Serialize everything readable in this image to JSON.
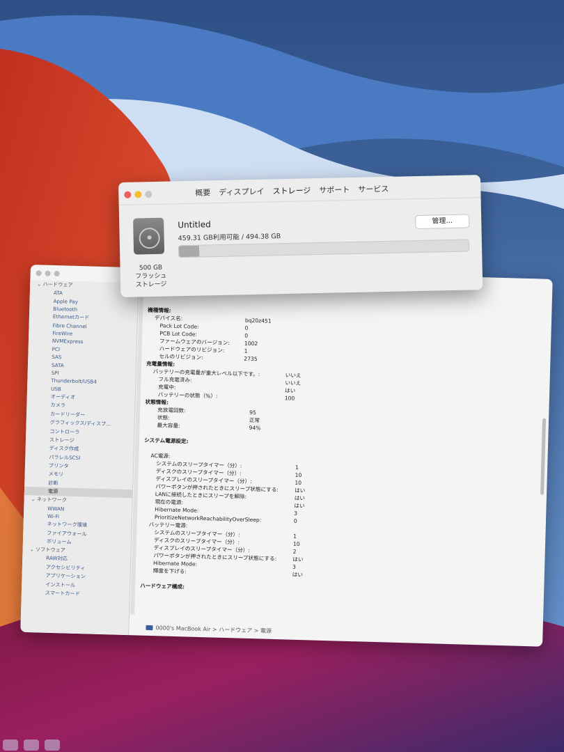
{
  "colors": {
    "close": "#ee5f57",
    "minimize": "#f5bd2f",
    "zoom_inactive": "#c7c7c7",
    "accent": "#3b5d9c"
  },
  "about_window": {
    "tabs": [
      "概要",
      "ディスプレイ",
      "ストレージ",
      "サポート",
      "サービス"
    ],
    "active_tab": "ストレージ",
    "volume_name": "Untitled",
    "usage": "459.31 GB利用可能 / 494.38 GB",
    "used_fraction": 0.07,
    "disk_label_lines": [
      "500 GB",
      "フラッシュ",
      "ストレージ"
    ],
    "manage_button": "管理...",
    "disk_icon": "hard-disk-icon"
  },
  "sidebar": {
    "hardware_group": "ハードウェア",
    "hardware_items": [
      "ATA",
      "Apple Pay",
      "Bluetooth",
      "Ethernetカード",
      "Fibre Channel",
      "FireWire",
      "NVMExpress",
      "PCI",
      "SAS",
      "SATA",
      "SPI",
      "Thunderbolt/USB4",
      "USB",
      "オーディオ",
      "カメラ",
      "カードリーダー",
      "グラフィックス/ディスプ...",
      "コントローラ",
      "ストレージ",
      "ディスク作成",
      "パラレルSCSI",
      "プリンタ",
      "メモリ",
      "診断",
      "電源"
    ],
    "selected_item": "電源",
    "network_group": "ネットワーク",
    "network_items": [
      "WWAN",
      "Wi-Fi",
      "ネットワーク環境",
      "ファイアウォール",
      "ボリューム"
    ],
    "software_group": "ソフトウェア",
    "software_items": [
      "RAW対応",
      "アクセシビリティ",
      "アプリケーション",
      "インストール",
      "スマートカード"
    ]
  },
  "content": {
    "rows": [
      {
        "k": "機種情報:",
        "v": "",
        "indent": 0,
        "bold": true
      },
      {
        "k": "デバイス名:",
        "v": "bq20z451",
        "indent": 1
      },
      {
        "k": "Pack Lot Code:",
        "v": "0",
        "indent": 2
      },
      {
        "k": "PCB Lot Code:",
        "v": "0",
        "indent": 2
      },
      {
        "k": "ファームウェアのバージョン:",
        "v": "1002",
        "indent": 2
      },
      {
        "k": "ハードウェアのリビジョン:",
        "v": "1",
        "indent": 2
      },
      {
        "k": "セルのリビジョン:",
        "v": "2735",
        "indent": 2
      },
      {
        "k": "充電量情報:",
        "v": "",
        "indent": 0,
        "bold": true
      },
      {
        "k": "バッテリーの充電量が重大レベル以下です。:",
        "v": "いいえ",
        "indent": 1,
        "vcol": 2
      },
      {
        "k": "フル充電済み:",
        "v": "いいえ",
        "indent": 2,
        "vcol": 2
      },
      {
        "k": "充電中:",
        "v": "はい",
        "indent": 2,
        "vcol": 2
      },
      {
        "k": "バッテリーの状態（%）:",
        "v": "100",
        "indent": 2,
        "vcol": 2
      },
      {
        "k": "状態情報:",
        "v": "",
        "indent": 0,
        "bold": true
      },
      {
        "k": "充放電回数:",
        "v": "95",
        "indent": 2,
        "vcol": 1
      },
      {
        "k": "状態:",
        "v": "正常",
        "indent": 2,
        "vcol": 1
      },
      {
        "k": "最大容量:",
        "v": "94%",
        "indent": 2,
        "vcol": 1
      },
      {
        "k": "",
        "v": "",
        "indent": 0
      },
      {
        "k": "システム電源設定:",
        "v": "",
        "indent": 0,
        "bold": true
      },
      {
        "k": "",
        "v": "",
        "indent": 0
      },
      {
        "k": "AC電源:",
        "v": "",
        "indent": 1
      },
      {
        "k": "システムのスリープタイマー（分）:",
        "v": "1",
        "indent": 2,
        "vcol": 3
      },
      {
        "k": "ディスクのスリープタイマー（分）:",
        "v": "10",
        "indent": 2,
        "vcol": 3
      },
      {
        "k": "ディスプレイのスリープタイマー（分）:",
        "v": "10",
        "indent": 2,
        "vcol": 3
      },
      {
        "k": "パワーボタンが押されたときにスリープ状態にする:",
        "v": "はい",
        "indent": 2,
        "vcol": 3
      },
      {
        "k": "LANに接続したときにスリープを解除:",
        "v": "はい",
        "indent": 2,
        "vcol": 3
      },
      {
        "k": "現在の電源:",
        "v": "はい",
        "indent": 2,
        "vcol": 3
      },
      {
        "k": "Hibernate Mode:",
        "v": "3",
        "indent": 2,
        "vcol": 3
      },
      {
        "k": "PrioritizeNetworkReachabilityOverSleep:",
        "v": "0",
        "indent": 2,
        "vcol": 3
      },
      {
        "k": "バッテリー電源:",
        "v": "",
        "indent": 1
      },
      {
        "k": "システムのスリープタイマー（分）:",
        "v": "1",
        "indent": 2,
        "vcol": 3
      },
      {
        "k": "ディスクのスリープタイマー（分）:",
        "v": "10",
        "indent": 2,
        "vcol": 3
      },
      {
        "k": "ディスプレイのスリープタイマー（分）:",
        "v": "2",
        "indent": 2,
        "vcol": 3
      },
      {
        "k": "パワーボタンが押されたときにスリープ状態にする:",
        "v": "はい",
        "indent": 2,
        "vcol": 3
      },
      {
        "k": "Hibernate Mode:",
        "v": "3",
        "indent": 2,
        "vcol": 3
      },
      {
        "k": "輝度を下げる:",
        "v": "はい",
        "indent": 2,
        "vcol": 3
      },
      {
        "k": "",
        "v": "",
        "indent": 0
      },
      {
        "k": "ハードウェア構成:",
        "v": "",
        "indent": 0,
        "bold": true
      }
    ]
  },
  "pathbar": {
    "text": "0000's MacBook Air > ハードウェア > 電源",
    "icon": "laptop-icon"
  }
}
